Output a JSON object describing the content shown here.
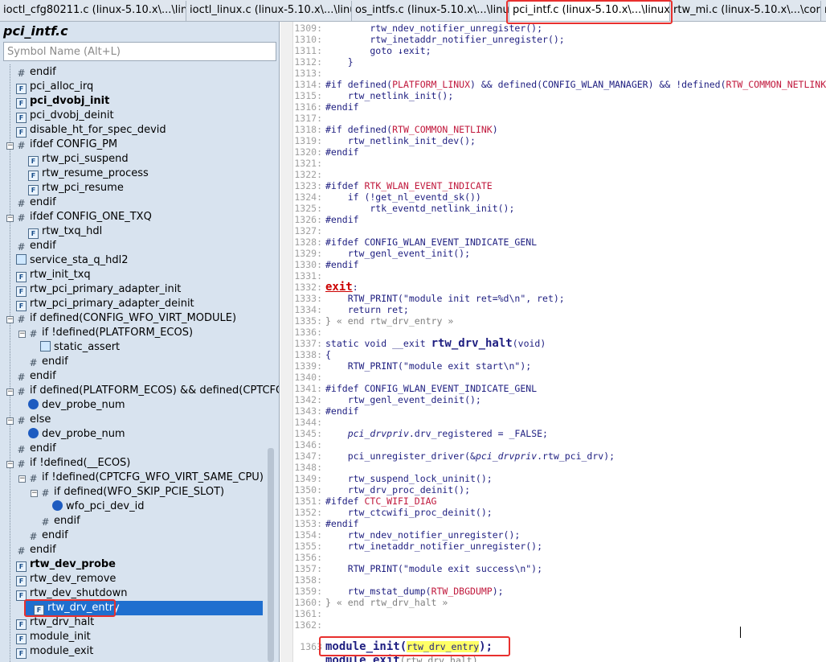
{
  "tabs": [
    {
      "label": "ioctl_cfg80211.c (linux-5.10.x\\...\\linux)",
      "active": false
    },
    {
      "label": "ioctl_linux.c (linux-5.10.x\\...\\linux)",
      "active": false
    },
    {
      "label": "os_intfs.c (linux-5.10.x\\...\\linux)",
      "active": false
    },
    {
      "label": "pci_intf.c (linux-5.10.x\\...\\linux)",
      "active": true,
      "close": "×"
    },
    {
      "label": "rtw_mi.c (linux-5.10.x\\...\\core)",
      "active": false
    },
    {
      "label": "r",
      "active": false
    }
  ],
  "symbol_panel": {
    "file_title": "pci_intf.c",
    "search_placeholder": "Symbol Name (Alt+L)",
    "items": [
      {
        "label": "endif",
        "icon": "preprocessor-icon",
        "depth": 0
      },
      {
        "label": "pci_alloc_irq",
        "icon": "function-icon",
        "depth": 0
      },
      {
        "label": "pci_dvobj_init",
        "icon": "function-icon",
        "depth": 0,
        "bold": true
      },
      {
        "label": "pci_dvobj_deinit",
        "icon": "function-icon",
        "depth": 0
      },
      {
        "label": "disable_ht_for_spec_devid",
        "icon": "function-icon",
        "depth": 0
      },
      {
        "label": "ifdef CONFIG_PM",
        "icon": "preprocessor-icon",
        "depth": 0,
        "expander": "−"
      },
      {
        "label": "rtw_pci_suspend",
        "icon": "function-icon",
        "depth": 1
      },
      {
        "label": "rtw_resume_process",
        "icon": "function-icon",
        "depth": 1
      },
      {
        "label": "rtw_pci_resume",
        "icon": "function-icon",
        "depth": 1
      },
      {
        "label": "endif",
        "icon": "preprocessor-icon",
        "depth": 0
      },
      {
        "label": "ifdef CONFIG_ONE_TXQ",
        "icon": "preprocessor-icon",
        "depth": 0,
        "expander": "−"
      },
      {
        "label": "rtw_txq_hdl",
        "icon": "function-icon",
        "depth": 1
      },
      {
        "label": "endif",
        "icon": "preprocessor-icon",
        "depth": 0
      },
      {
        "label": "service_sta_q_hdl2",
        "icon": "handler-icon",
        "depth": 0
      },
      {
        "label": "rtw_init_txq",
        "icon": "function-icon",
        "depth": 0
      },
      {
        "label": "rtw_pci_primary_adapter_init",
        "icon": "function-icon",
        "depth": 0
      },
      {
        "label": "rtw_pci_primary_adapter_deinit",
        "icon": "function-icon",
        "depth": 0
      },
      {
        "label": "if defined(CONFIG_WFO_VIRT_MODULE)",
        "icon": "preprocessor-icon",
        "depth": 0,
        "expander": "−"
      },
      {
        "label": "if !defined(PLATFORM_ECOS)",
        "icon": "preprocessor-icon",
        "depth": 1,
        "expander": "−"
      },
      {
        "label": "static_assert",
        "icon": "handler-icon",
        "depth": 2
      },
      {
        "label": "endif",
        "icon": "preprocessor-icon",
        "depth": 1
      },
      {
        "label": "endif",
        "icon": "preprocessor-icon",
        "depth": 0
      },
      {
        "label": "if defined(PLATFORM_ECOS) && defined(CPTCFG_WFO_",
        "icon": "preprocessor-icon",
        "depth": 0,
        "expander": "−"
      },
      {
        "label": "dev_probe_num",
        "icon": "variable-icon",
        "depth": 1
      },
      {
        "label": "else",
        "icon": "preprocessor-icon",
        "depth": 0,
        "expander": "−"
      },
      {
        "label": "dev_probe_num",
        "icon": "variable-icon",
        "depth": 1
      },
      {
        "label": "endif",
        "icon": "preprocessor-icon",
        "depth": 0
      },
      {
        "label": "if !defined(__ECOS)",
        "icon": "preprocessor-icon",
        "depth": 0,
        "expander": "−"
      },
      {
        "label": "if !defined(CPTCFG_WFO_VIRT_SAME_CPU)",
        "icon": "preprocessor-icon",
        "depth": 1,
        "expander": "−"
      },
      {
        "label": "if defined(WFO_SKIP_PCIE_SLOT)",
        "icon": "preprocessor-icon",
        "depth": 2,
        "expander": "−"
      },
      {
        "label": "wfo_pci_dev_id",
        "icon": "variable-icon",
        "depth": 3
      },
      {
        "label": "endif",
        "icon": "preprocessor-icon",
        "depth": 2
      },
      {
        "label": "endif",
        "icon": "preprocessor-icon",
        "depth": 1
      },
      {
        "label": "endif",
        "icon": "preprocessor-icon",
        "depth": 0
      },
      {
        "label": "rtw_dev_probe",
        "icon": "function-icon",
        "depth": 0,
        "bold": true
      },
      {
        "label": "rtw_dev_remove",
        "icon": "function-icon",
        "depth": 0
      },
      {
        "label": "rtw_dev_shutdown",
        "icon": "function-icon",
        "depth": 0
      },
      {
        "label": "rtw_drv_entry",
        "icon": "function-icon",
        "depth": 0,
        "selected": true
      },
      {
        "label": "rtw_drv_halt",
        "icon": "function-icon",
        "depth": 0
      },
      {
        "label": "module_init",
        "icon": "function-icon",
        "depth": 0
      },
      {
        "label": "module_exit",
        "icon": "function-icon",
        "depth": 0
      }
    ]
  },
  "editor": {
    "lines": [
      {
        "no": "1309:",
        "parts": [
          {
            "t": "        rtw_ndev_notifier_unregister();",
            "c": "code-text"
          }
        ]
      },
      {
        "no": "1310:",
        "parts": [
          {
            "t": "        rtw_inetaddr_notifier_unregister();",
            "c": "code-text"
          }
        ]
      },
      {
        "no": "1311:",
        "parts": [
          {
            "t": "        goto ",
            "c": "kw"
          },
          {
            "t": "↓exit;",
            "c": "code-text"
          }
        ]
      },
      {
        "no": "1312:",
        "parts": [
          {
            "t": "    }",
            "c": "code-text"
          }
        ]
      },
      {
        "no": "1313:",
        "parts": [
          {
            "t": "",
            "c": "code-text"
          }
        ]
      },
      {
        "no": "1314:",
        "parts": [
          {
            "t": "#if defined(",
            "c": "kw"
          },
          {
            "t": "PLATFORM_LINUX",
            "c": "red"
          },
          {
            "t": ") && defined(CONFIG_WLAN_MANAGER) && !defined(",
            "c": "kw"
          },
          {
            "t": "RTW_COMMON_NETLINK",
            "c": "red"
          }
        ]
      },
      {
        "no": "1315:",
        "parts": [
          {
            "t": "    rtw_netlink_init();",
            "c": "code-text"
          }
        ]
      },
      {
        "no": "1316:",
        "parts": [
          {
            "t": "#endif",
            "c": "kw"
          }
        ]
      },
      {
        "no": "1317:",
        "parts": [
          {
            "t": "",
            "c": "code-text"
          }
        ]
      },
      {
        "no": "1318:",
        "parts": [
          {
            "t": "#if defined(",
            "c": "kw"
          },
          {
            "t": "RTW_COMMON_NETLINK",
            "c": "red"
          },
          {
            "t": ")",
            "c": "kw"
          }
        ]
      },
      {
        "no": "1319:",
        "parts": [
          {
            "t": "    rtw_netlink_init_dev();",
            "c": "code-text"
          }
        ]
      },
      {
        "no": "1320:",
        "parts": [
          {
            "t": "#endif",
            "c": "kw"
          }
        ]
      },
      {
        "no": "1321:",
        "parts": [
          {
            "t": "",
            "c": "code-text"
          }
        ]
      },
      {
        "no": "1322:",
        "parts": [
          {
            "t": "",
            "c": "code-text"
          }
        ]
      },
      {
        "no": "1323:",
        "parts": [
          {
            "t": "#ifdef ",
            "c": "kw"
          },
          {
            "t": "RTK_WLAN_EVENT_INDICATE",
            "c": "red"
          }
        ]
      },
      {
        "no": "1324:",
        "parts": [
          {
            "t": "    if (!get_nl_eventd_sk())",
            "c": "code-text"
          }
        ]
      },
      {
        "no": "1325:",
        "parts": [
          {
            "t": "        rtk_eventd_netlink_init();",
            "c": "code-text"
          }
        ]
      },
      {
        "no": "1326:",
        "parts": [
          {
            "t": "#endif",
            "c": "kw"
          }
        ]
      },
      {
        "no": "1327:",
        "parts": [
          {
            "t": "",
            "c": "code-text"
          }
        ]
      },
      {
        "no": "1328:",
        "parts": [
          {
            "t": "#ifdef CONFIG_WLAN_EVENT_INDICATE_GENL",
            "c": "kw"
          }
        ]
      },
      {
        "no": "1329:",
        "parts": [
          {
            "t": "    rtw_genl_event_init();",
            "c": "code-text"
          }
        ]
      },
      {
        "no": "1330:",
        "parts": [
          {
            "t": "#endif",
            "c": "kw"
          }
        ]
      },
      {
        "no": "1331:",
        "parts": [
          {
            "t": "",
            "c": "code-text"
          }
        ]
      },
      {
        "no": "1332:",
        "parts": [
          {
            "t": "exit",
            "c": "label-red big"
          },
          {
            "t": ":",
            "c": "code-text"
          }
        ]
      },
      {
        "no": "1333:",
        "parts": [
          {
            "t": "    RTW_PRINT(\"module init ret=%d\\n\", ret);",
            "c": "code-text"
          }
        ]
      },
      {
        "no": "1334:",
        "parts": [
          {
            "t": "    return ret;",
            "c": "code-text"
          }
        ]
      },
      {
        "no": "1335:",
        "parts": [
          {
            "t": "} « end rtw_drv_entry »",
            "c": "comment"
          }
        ]
      },
      {
        "no": "1336:",
        "parts": [
          {
            "t": "",
            "c": "code-text"
          }
        ]
      },
      {
        "no": "1337:",
        "parts": [
          {
            "t": "static void __exit ",
            "c": "kw"
          },
          {
            "t": "rtw_drv_halt",
            "c": "code-text big"
          },
          {
            "t": "(void)",
            "c": "code-text"
          }
        ]
      },
      {
        "no": "1338:",
        "parts": [
          {
            "t": "{",
            "c": "code-text"
          }
        ]
      },
      {
        "no": "1339:",
        "parts": [
          {
            "t": "    RTW_PRINT(\"module exit start\\n\");",
            "c": "code-text"
          }
        ]
      },
      {
        "no": "1340:",
        "parts": [
          {
            "t": "",
            "c": "code-text"
          }
        ]
      },
      {
        "no": "1341:",
        "parts": [
          {
            "t": "#ifdef CONFIG_WLAN_EVENT_INDICATE_GENL",
            "c": "kw"
          }
        ]
      },
      {
        "no": "1342:",
        "parts": [
          {
            "t": "    rtw_genl_event_deinit();",
            "c": "code-text"
          }
        ]
      },
      {
        "no": "1343:",
        "parts": [
          {
            "t": "#endif",
            "c": "kw"
          }
        ]
      },
      {
        "no": "1344:",
        "parts": [
          {
            "t": "",
            "c": "code-text"
          }
        ]
      },
      {
        "no": "1345:",
        "parts": [
          {
            "t": "    ",
            "c": "code-text"
          },
          {
            "t": "pci_drvpriv",
            "c": "var"
          },
          {
            "t": ".drv_registered = _FALSE;",
            "c": "code-text"
          }
        ]
      },
      {
        "no": "1346:",
        "parts": [
          {
            "t": "",
            "c": "code-text"
          }
        ]
      },
      {
        "no": "1347:",
        "parts": [
          {
            "t": "    pci_unregister_driver(&",
            "c": "code-text"
          },
          {
            "t": "pci_drvpriv",
            "c": "var"
          },
          {
            "t": ".rtw_pci_drv);",
            "c": "code-text"
          }
        ]
      },
      {
        "no": "1348:",
        "parts": [
          {
            "t": "",
            "c": "code-text"
          }
        ]
      },
      {
        "no": "1349:",
        "parts": [
          {
            "t": "    rtw_suspend_lock_uninit();",
            "c": "code-text"
          }
        ]
      },
      {
        "no": "1350:",
        "parts": [
          {
            "t": "    rtw_drv_proc_deinit();",
            "c": "code-text"
          }
        ]
      },
      {
        "no": "1351:",
        "parts": [
          {
            "t": "#ifdef ",
            "c": "kw"
          },
          {
            "t": "CTC_WIFI_DIAG",
            "c": "red"
          }
        ]
      },
      {
        "no": "1352:",
        "parts": [
          {
            "t": "    rtw_ctcwifi_proc_deinit();",
            "c": "code-text"
          }
        ]
      },
      {
        "no": "1353:",
        "parts": [
          {
            "t": "#endif",
            "c": "kw"
          }
        ]
      },
      {
        "no": "1354:",
        "parts": [
          {
            "t": "    rtw_ndev_notifier_unregister();",
            "c": "code-text"
          }
        ]
      },
      {
        "no": "1355:",
        "parts": [
          {
            "t": "    rtw_inetaddr_notifier_unregister();",
            "c": "code-text"
          }
        ]
      },
      {
        "no": "1356:",
        "parts": [
          {
            "t": "",
            "c": "code-text"
          }
        ]
      },
      {
        "no": "1357:",
        "parts": [
          {
            "t": "    RTW_PRINT(\"module exit success\\n\");",
            "c": "code-text"
          }
        ]
      },
      {
        "no": "1358:",
        "parts": [
          {
            "t": "",
            "c": "code-text"
          }
        ]
      },
      {
        "no": "1359:",
        "parts": [
          {
            "t": "    rtw_mstat_dump(",
            "c": "code-text"
          },
          {
            "t": "RTW_DBGDUMP",
            "c": "red"
          },
          {
            "t": ");",
            "c": "code-text"
          }
        ]
      },
      {
        "no": "1360:",
        "parts": [
          {
            "t": "} « end rtw_drv_halt »",
            "c": "comment"
          }
        ]
      },
      {
        "no": "1361:",
        "parts": [
          {
            "t": "",
            "c": "code-text"
          }
        ]
      },
      {
        "no": "1362:",
        "parts": [
          {
            "t": "",
            "c": "code-text"
          }
        ]
      },
      {
        "no": "1363",
        "parts": [
          {
            "t": "module_init",
            "c": "code-text big"
          },
          {
            "t": "(",
            "c": "code-text big"
          },
          {
            "t": "rtw_drv_entry",
            "c": "code-text hl"
          },
          {
            "t": ");",
            "c": "code-text big"
          }
        ]
      },
      {
        "no": "",
        "parts": [
          {
            "t": "module_exit",
            "c": "code-text big"
          },
          {
            "t": "(rtw_drv_halt)",
            "c": "comment"
          }
        ]
      }
    ]
  }
}
